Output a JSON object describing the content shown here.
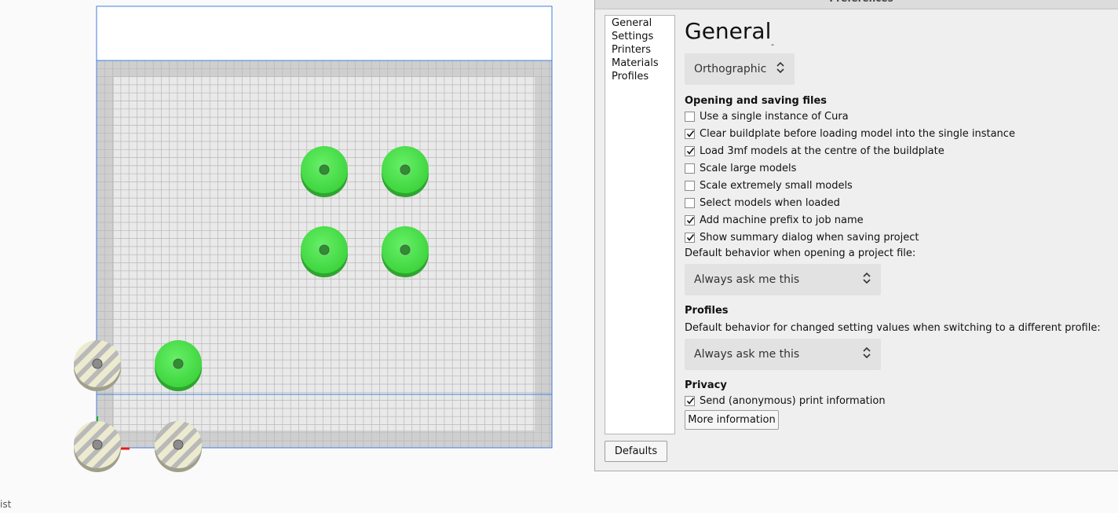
{
  "viewport": {
    "status_fragment": "ist",
    "colors": {
      "plate": "#e6e6e6",
      "grid_line": "#b9b9b9",
      "border_zone": "#cdcdcd",
      "volume_outline": "#3f7fe0",
      "model_green": "#4ee44e",
      "model_green_dark": "#32b032",
      "model_outside": "#e6e2c4",
      "stripe": "#b8b8b8"
    },
    "models": [
      {
        "id": "model-1",
        "state": "on-plate"
      },
      {
        "id": "model-2",
        "state": "on-plate"
      },
      {
        "id": "model-3",
        "state": "on-plate"
      },
      {
        "id": "model-4",
        "state": "on-plate"
      },
      {
        "id": "model-5",
        "state": "on-plate"
      },
      {
        "id": "model-6",
        "state": "outside-volume"
      },
      {
        "id": "model-7",
        "state": "outside-volume"
      },
      {
        "id": "model-8",
        "state": "outside-volume"
      }
    ]
  },
  "dialog": {
    "title": "Preferences",
    "nav_items": [
      "General",
      "Settings",
      "Printers",
      "Materials",
      "Profiles"
    ],
    "defaults_label": "Defaults",
    "page_title": "General",
    "tick_mark": "-",
    "camera_select": {
      "value": "Orthographic",
      "arrows": "⌃⌄"
    },
    "opening_saving": {
      "heading": "Opening and saving files",
      "items": [
        {
          "label": "Use a single instance of Cura",
          "checked": false
        },
        {
          "label": "Clear buildplate before loading model into the single instance",
          "checked": true
        },
        {
          "label": "Load 3mf models at the centre of the buildplate",
          "checked": true
        },
        {
          "label": "Scale large models",
          "checked": false
        },
        {
          "label": "Scale extremely small models",
          "checked": false
        },
        {
          "label": "Select models when loaded",
          "checked": false
        },
        {
          "label": "Add machine prefix to job name",
          "checked": true
        },
        {
          "label": "Show summary dialog when saving project",
          "checked": true
        }
      ],
      "project_behavior_label": "Default behavior when opening a project file:",
      "project_behavior_select": "Always ask me this"
    },
    "profiles": {
      "heading": "Profiles",
      "label": "Default behavior for changed setting values when switching to a different profile:",
      "select": "Always ask me this"
    },
    "privacy": {
      "heading": "Privacy",
      "send_info": {
        "label": "Send (anonymous) print information",
        "checked": true
      },
      "more_info_label": "More information"
    }
  }
}
